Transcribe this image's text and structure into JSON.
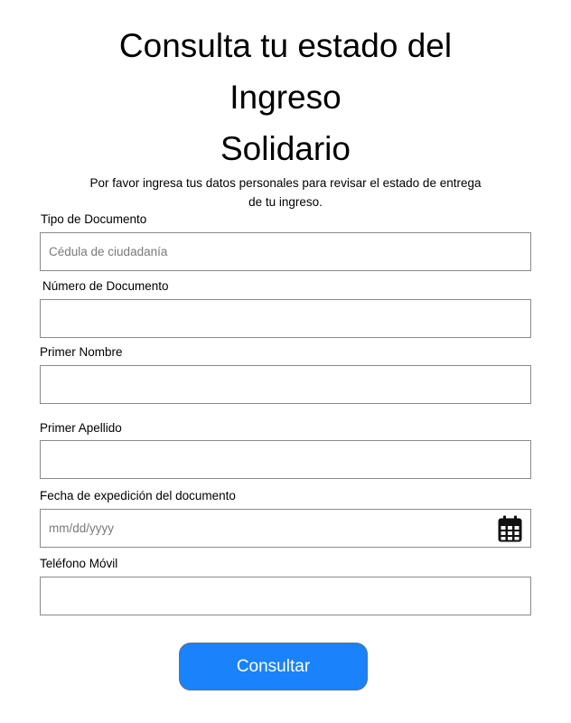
{
  "header": {
    "title_lines": [
      "Consulta tu estado del",
      "Ingreso",
      "Solidario"
    ],
    "subtitle_lines": [
      "Por favor ingresa tus datos personales para revisar el estado de entrega",
      "de tu ingreso."
    ]
  },
  "form": {
    "fields": [
      {
        "label": "Tipo de Documento",
        "value": "",
        "placeholder": "Cédula de ciudadanía"
      },
      {
        "label": "Número de Documento",
        "value": "",
        "placeholder": ""
      },
      {
        "label": "Primer Nombre",
        "value": "",
        "placeholder": ""
      },
      {
        "label": "Primer Apellido",
        "value": "",
        "placeholder": ""
      },
      {
        "label": "Fecha de expedición del documento",
        "value": "",
        "placeholder": "mm/dd/yyyy",
        "icon": "calendar-icon"
      },
      {
        "label": "Teléfono Móvil",
        "value": "",
        "placeholder": ""
      }
    ],
    "submit_label": "Consultar"
  },
  "colors": {
    "button_background": "#1a82fb",
    "button_text": "#ffffff",
    "field_border": "#8a8a8a",
    "placeholder_text": "#7a7a7a"
  }
}
